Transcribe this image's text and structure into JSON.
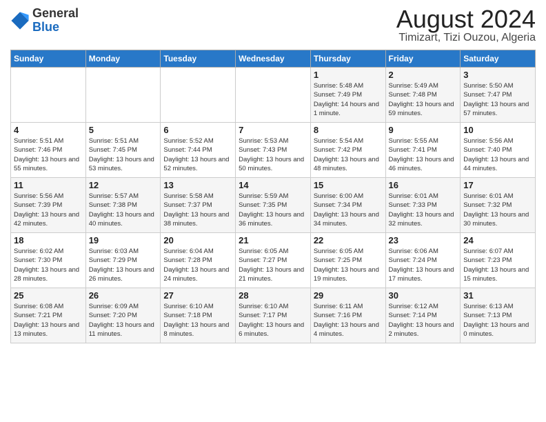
{
  "header": {
    "logo_general": "General",
    "logo_blue": "Blue",
    "title": "August 2024",
    "subtitle": "Timizart, Tizi Ouzou, Algeria"
  },
  "days_of_week": [
    "Sunday",
    "Monday",
    "Tuesday",
    "Wednesday",
    "Thursday",
    "Friday",
    "Saturday"
  ],
  "weeks": [
    [
      {
        "num": "",
        "info": ""
      },
      {
        "num": "",
        "info": ""
      },
      {
        "num": "",
        "info": ""
      },
      {
        "num": "",
        "info": ""
      },
      {
        "num": "1",
        "info": "Sunrise: 5:48 AM\nSunset: 7:49 PM\nDaylight: 14 hours and 1 minute."
      },
      {
        "num": "2",
        "info": "Sunrise: 5:49 AM\nSunset: 7:48 PM\nDaylight: 13 hours and 59 minutes."
      },
      {
        "num": "3",
        "info": "Sunrise: 5:50 AM\nSunset: 7:47 PM\nDaylight: 13 hours and 57 minutes."
      }
    ],
    [
      {
        "num": "4",
        "info": "Sunrise: 5:51 AM\nSunset: 7:46 PM\nDaylight: 13 hours and 55 minutes."
      },
      {
        "num": "5",
        "info": "Sunrise: 5:51 AM\nSunset: 7:45 PM\nDaylight: 13 hours and 53 minutes."
      },
      {
        "num": "6",
        "info": "Sunrise: 5:52 AM\nSunset: 7:44 PM\nDaylight: 13 hours and 52 minutes."
      },
      {
        "num": "7",
        "info": "Sunrise: 5:53 AM\nSunset: 7:43 PM\nDaylight: 13 hours and 50 minutes."
      },
      {
        "num": "8",
        "info": "Sunrise: 5:54 AM\nSunset: 7:42 PM\nDaylight: 13 hours and 48 minutes."
      },
      {
        "num": "9",
        "info": "Sunrise: 5:55 AM\nSunset: 7:41 PM\nDaylight: 13 hours and 46 minutes."
      },
      {
        "num": "10",
        "info": "Sunrise: 5:56 AM\nSunset: 7:40 PM\nDaylight: 13 hours and 44 minutes."
      }
    ],
    [
      {
        "num": "11",
        "info": "Sunrise: 5:56 AM\nSunset: 7:39 PM\nDaylight: 13 hours and 42 minutes."
      },
      {
        "num": "12",
        "info": "Sunrise: 5:57 AM\nSunset: 7:38 PM\nDaylight: 13 hours and 40 minutes."
      },
      {
        "num": "13",
        "info": "Sunrise: 5:58 AM\nSunset: 7:37 PM\nDaylight: 13 hours and 38 minutes."
      },
      {
        "num": "14",
        "info": "Sunrise: 5:59 AM\nSunset: 7:35 PM\nDaylight: 13 hours and 36 minutes."
      },
      {
        "num": "15",
        "info": "Sunrise: 6:00 AM\nSunset: 7:34 PM\nDaylight: 13 hours and 34 minutes."
      },
      {
        "num": "16",
        "info": "Sunrise: 6:01 AM\nSunset: 7:33 PM\nDaylight: 13 hours and 32 minutes."
      },
      {
        "num": "17",
        "info": "Sunrise: 6:01 AM\nSunset: 7:32 PM\nDaylight: 13 hours and 30 minutes."
      }
    ],
    [
      {
        "num": "18",
        "info": "Sunrise: 6:02 AM\nSunset: 7:30 PM\nDaylight: 13 hours and 28 minutes."
      },
      {
        "num": "19",
        "info": "Sunrise: 6:03 AM\nSunset: 7:29 PM\nDaylight: 13 hours and 26 minutes."
      },
      {
        "num": "20",
        "info": "Sunrise: 6:04 AM\nSunset: 7:28 PM\nDaylight: 13 hours and 24 minutes."
      },
      {
        "num": "21",
        "info": "Sunrise: 6:05 AM\nSunset: 7:27 PM\nDaylight: 13 hours and 21 minutes."
      },
      {
        "num": "22",
        "info": "Sunrise: 6:05 AM\nSunset: 7:25 PM\nDaylight: 13 hours and 19 minutes."
      },
      {
        "num": "23",
        "info": "Sunrise: 6:06 AM\nSunset: 7:24 PM\nDaylight: 13 hours and 17 minutes."
      },
      {
        "num": "24",
        "info": "Sunrise: 6:07 AM\nSunset: 7:23 PM\nDaylight: 13 hours and 15 minutes."
      }
    ],
    [
      {
        "num": "25",
        "info": "Sunrise: 6:08 AM\nSunset: 7:21 PM\nDaylight: 13 hours and 13 minutes."
      },
      {
        "num": "26",
        "info": "Sunrise: 6:09 AM\nSunset: 7:20 PM\nDaylight: 13 hours and 11 minutes."
      },
      {
        "num": "27",
        "info": "Sunrise: 6:10 AM\nSunset: 7:18 PM\nDaylight: 13 hours and 8 minutes."
      },
      {
        "num": "28",
        "info": "Sunrise: 6:10 AM\nSunset: 7:17 PM\nDaylight: 13 hours and 6 minutes."
      },
      {
        "num": "29",
        "info": "Sunrise: 6:11 AM\nSunset: 7:16 PM\nDaylight: 13 hours and 4 minutes."
      },
      {
        "num": "30",
        "info": "Sunrise: 6:12 AM\nSunset: 7:14 PM\nDaylight: 13 hours and 2 minutes."
      },
      {
        "num": "31",
        "info": "Sunrise: 6:13 AM\nSunset: 7:13 PM\nDaylight: 13 hours and 0 minutes."
      }
    ]
  ]
}
